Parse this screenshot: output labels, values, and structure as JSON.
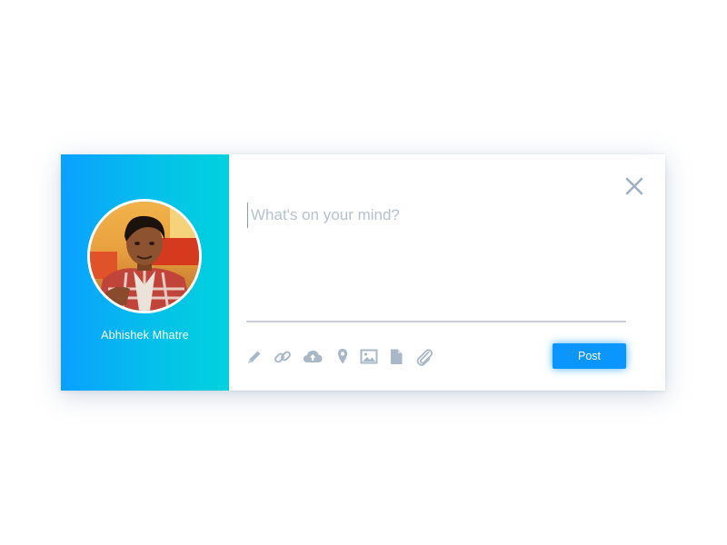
{
  "profile": {
    "name": "Abhishek Mhatre",
    "avatar_alt": "Profile photo"
  },
  "composer": {
    "placeholder": "What's on your mind?",
    "value": ""
  },
  "toolbar": {
    "icons": [
      "pencil-icon",
      "link-icon",
      "cloud-upload-icon",
      "location-pin-icon",
      "image-icon",
      "document-icon",
      "paperclip-icon"
    ]
  },
  "actions": {
    "post_label": "Post",
    "close_icon": "close-icon"
  },
  "colors": {
    "accent": "#0a95ff",
    "gradient_start": "#0aa0ff",
    "gradient_end": "#00d2dd",
    "icon": "#a9b8c7"
  }
}
